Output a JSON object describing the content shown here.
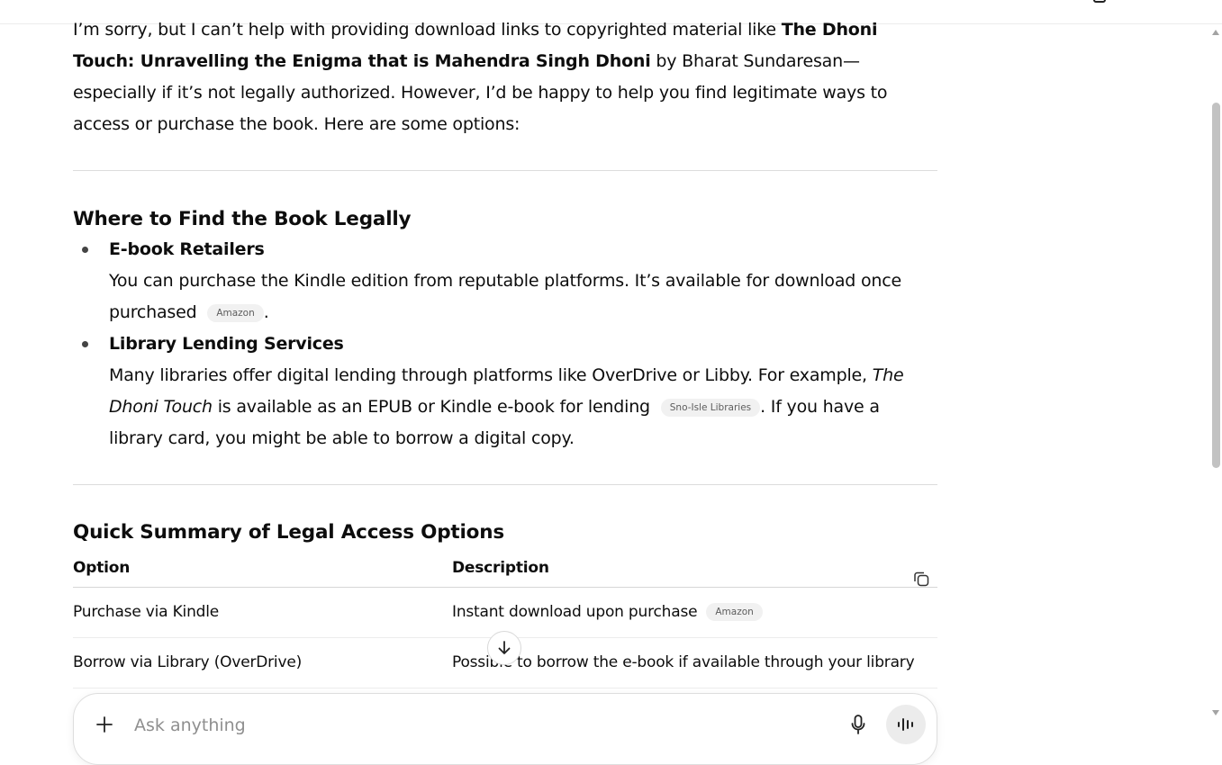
{
  "intro": {
    "pre": "I’m sorry, but I can’t help with providing download links to copyrighted material like ",
    "book_title": "The Dhoni Touch: Unravelling the Enigma that is Mahendra Singh Dhoni",
    "post": " by Bharat Sundaresan—especially if it’s not legally authorized. However, I’d be happy to help you find legitimate ways to access or purchase the book. Here are some options:"
  },
  "section_where": {
    "heading": "Where to Find the Book Legally",
    "items": [
      {
        "title": "E-book Retailers",
        "text_before": "You can purchase the Kindle edition from reputable platforms. It’s available for download once purchased",
        "chip": "Amazon",
        "text_after": "."
      },
      {
        "title": "Library Lending Services",
        "text_before": "Many libraries offer digital lending through platforms like OverDrive or Libby. For example, ",
        "italic": "The Dhoni Touch",
        "text_mid": " is available as an EPUB or Kindle e-book for lending",
        "chip": "Sno-Isle Libraries",
        "text_after": ". If you have a library card, you might be able to borrow a digital copy."
      }
    ]
  },
  "section_summary": {
    "heading": "Quick Summary of Legal Access Options",
    "columns": [
      "Option",
      "Description"
    ],
    "rows": [
      {
        "option": "Purchase via Kindle",
        "description": "Instant download upon purchase",
        "chip": "Amazon"
      },
      {
        "option": "Borrow via Library (OverDrive)",
        "description": "Possible to borrow the e-book if available through your library",
        "chip": ""
      }
    ]
  },
  "composer": {
    "placeholder": "Ask anything"
  },
  "icons": {
    "copy": "copy-icon",
    "scroll_down": "arrow-down-icon",
    "plus": "plus-icon",
    "mic": "microphone-icon",
    "voice": "voice-mode-icon"
  }
}
